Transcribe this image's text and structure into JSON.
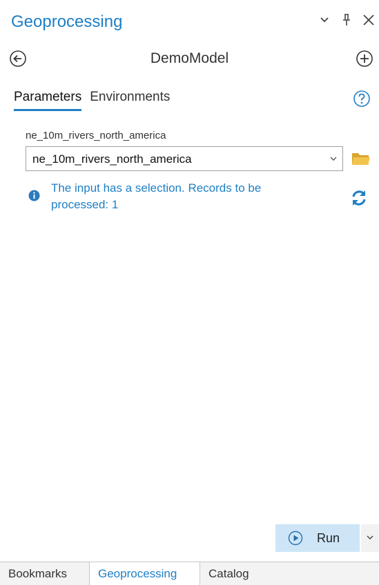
{
  "pane": {
    "title": "Geoprocessing",
    "icons": [
      "chevron-down-icon",
      "pin-icon",
      "close-icon"
    ]
  },
  "tool": {
    "name": "DemoModel",
    "back_icon": "back-arrow-icon",
    "add_icon": "add-icon"
  },
  "tabs": [
    {
      "label": "Parameters",
      "active": true
    },
    {
      "label": "Environments",
      "active": false
    }
  ],
  "help_icon": "help-icon",
  "parameter": {
    "label": "ne_10m_rivers_north_america",
    "value": "ne_10m_rivers_north_america",
    "browse_icon": "folder-icon"
  },
  "message": {
    "icon": "info-icon",
    "text_line1": "The input has a selection. Records to be",
    "text_line2": "processed: 1",
    "refresh_icon": "refresh-icon"
  },
  "run": {
    "label": "Run",
    "icon": "play-icon",
    "dropdown_icon": "chevron-down-icon"
  },
  "bottom_tabs": [
    {
      "label": "Bookmarks",
      "active": false
    },
    {
      "label": "Geoprocessing",
      "active": true
    },
    {
      "label": "Catalog",
      "active": false
    }
  ],
  "colors": {
    "accent": "#1e7fc6",
    "run_button": "#cde5f7",
    "folder": "#e8b83a"
  }
}
